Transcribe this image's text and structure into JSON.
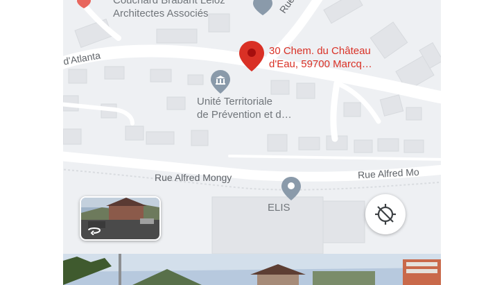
{
  "map": {
    "top_poi": {
      "line1": "Couchard Brabant Leloz",
      "line2": "Architectes Associés"
    },
    "road_labels": {
      "atlanta": "d'Atlanta",
      "rue_m": "Rue M",
      "alfred_left": "Rue Alfred Mongy",
      "alfred_right": "Rue Alfred Mo"
    },
    "pinned_place": {
      "line1": "30 Chem. du Château",
      "line2": "d'Eau, 59700 Marcq…",
      "color": "#d93025"
    },
    "unite": {
      "line1": "Unité Territoriale",
      "line2": "de Prévention et d…",
      "icon": "government-building-icon"
    },
    "elis": {
      "label": "ELIS",
      "icon": "place-pin-icon"
    },
    "street_view": {
      "icon": "rotate-360-icon"
    },
    "location_button": {
      "icon": "location-disabled-icon"
    }
  },
  "colors": {
    "map_background": "#eef0f3",
    "road": "#ffffff",
    "building": "#e2e4e8",
    "poi_marker": "#8a9aaa",
    "pin_red": "#d93025"
  }
}
